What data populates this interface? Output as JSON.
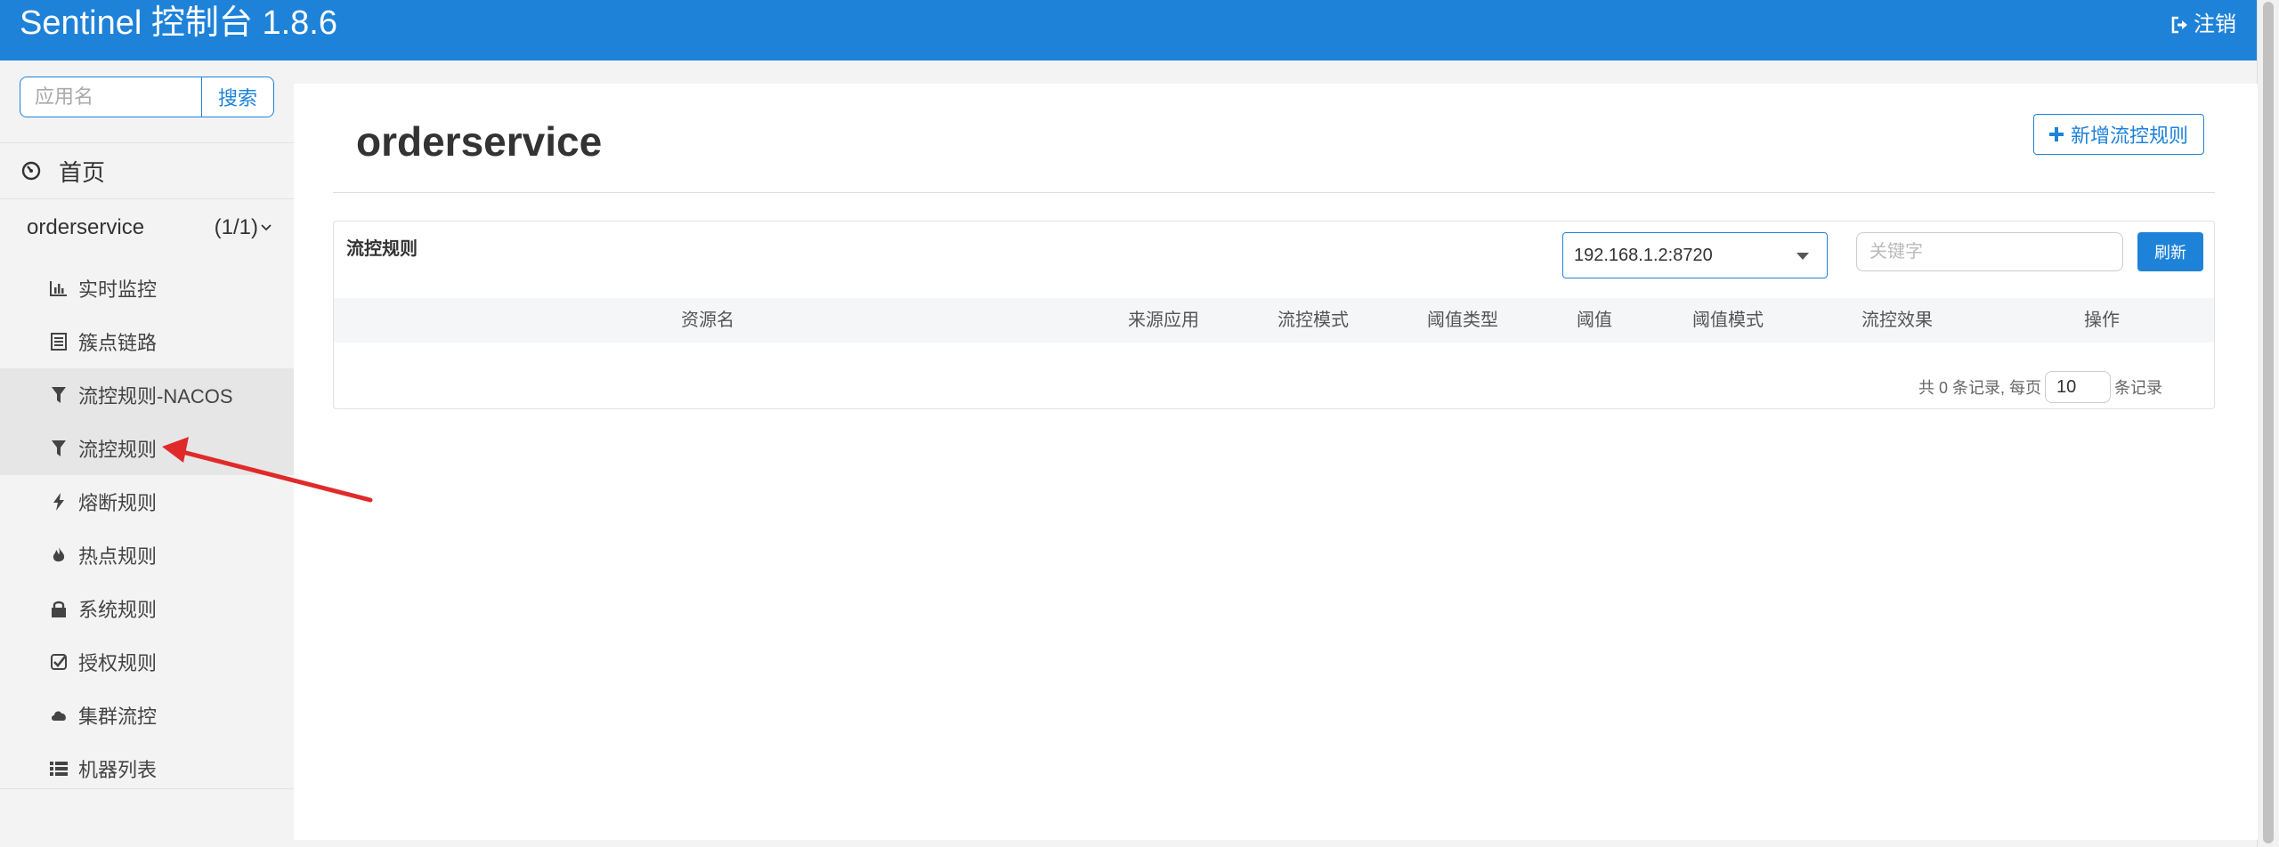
{
  "header": {
    "title": "Sentinel 控制台 1.8.6",
    "logout_label": "注销"
  },
  "sidebar": {
    "search": {
      "placeholder": "应用名",
      "button_label": "搜索"
    },
    "home_label": "首页",
    "app": {
      "name": "orderservice",
      "count": "(1/1)"
    },
    "items": [
      {
        "label": "实时监控",
        "icon": "bar-chart-icon"
      },
      {
        "label": "簇点链路",
        "icon": "list-alt-icon"
      },
      {
        "label": "流控规则-NACOS",
        "icon": "filter-icon"
      },
      {
        "label": "流控规则",
        "icon": "filter-icon"
      },
      {
        "label": "熔断规则",
        "icon": "flash-icon"
      },
      {
        "label": "热点规则",
        "icon": "fire-icon"
      },
      {
        "label": "系统规则",
        "icon": "lock-icon"
      },
      {
        "label": "授权规则",
        "icon": "check-icon"
      },
      {
        "label": "集群流控",
        "icon": "cloud-icon"
      },
      {
        "label": "机器列表",
        "icon": "th-list-icon"
      }
    ]
  },
  "main": {
    "title": "orderservice",
    "add_button_label": "新增流控规则",
    "panel": {
      "title": "流控规则",
      "machine": "192.168.1.2:8720",
      "keyword_placeholder": "关键字",
      "refresh_label": "刷新",
      "columns": [
        "资源名",
        "来源应用",
        "流控模式",
        "阈值类型",
        "阈值",
        "阈值模式",
        "流控效果",
        "操作"
      ],
      "rows": [],
      "pager": {
        "prefix": "共 0 条记录, 每页",
        "page_size": "10",
        "suffix": "条记录"
      }
    }
  },
  "colors": {
    "primary": "#1e82d9",
    "annotation_arrow": "#e02a2a"
  }
}
